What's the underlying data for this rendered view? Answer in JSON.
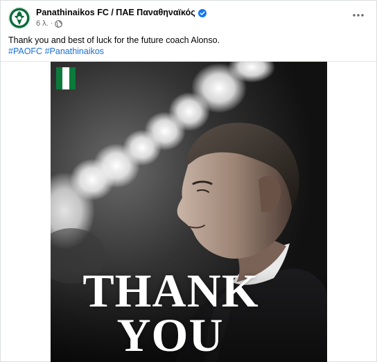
{
  "post": {
    "page_name": "Panathinaikos FC / ΠΑΕ Παναθηναϊκός",
    "time": "6 λ.",
    "separator": "·",
    "text": "Thank you and best of luck for the future coach Alonso.",
    "hashtags": [
      "#PAOFC",
      "#Panathinaikos"
    ],
    "more_icon": "more-horizontal-icon",
    "verified_icon": "verified-badge-icon",
    "audience_icon": "globe-icon"
  },
  "image": {
    "line1": "THANK",
    "line2": "YOU",
    "flag_colors": [
      "#0b7a3b",
      "#ffffff",
      "#0b7a3b"
    ]
  },
  "colors": {
    "link": "#1a6ed8",
    "verified": "#1877f2",
    "secondary_text": "#65676b",
    "primary_text": "#050505"
  }
}
